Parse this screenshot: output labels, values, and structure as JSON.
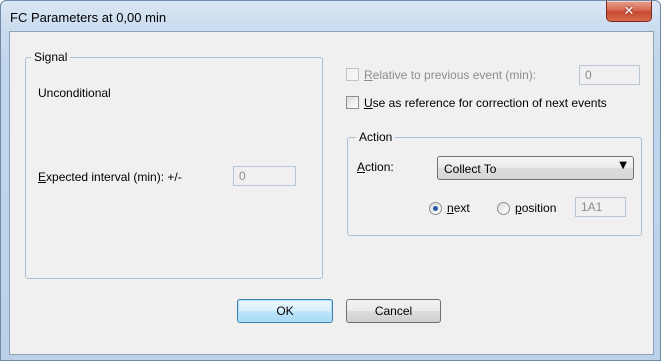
{
  "window": {
    "title": "FC Parameters at 0,00 min",
    "close_label": "✕"
  },
  "signal": {
    "legend": "Signal",
    "condition_text": "Unconditional",
    "expected_interval_label_key": "E",
    "expected_interval_label_rest": "xpected interval (min): +/-",
    "expected_interval_value": "0"
  },
  "relative": {
    "label_key": "R",
    "label_rest": "elative to previous event (min):",
    "checked": false,
    "enabled": false,
    "value": "0"
  },
  "use_reference": {
    "label_key": "U",
    "label_rest": "se as reference for correction of next events",
    "checked": false
  },
  "action_group": {
    "legend": "Action",
    "action_label_key": "A",
    "action_label_rest": "ction:",
    "action_value": "Collect To",
    "radio_next_key": "n",
    "radio_next_rest": "ext",
    "radio_position_key": "p",
    "radio_position_rest": "osition",
    "selected": "next",
    "position_value": "1A1"
  },
  "buttons": {
    "ok_label": "OK",
    "cancel_label": "Cancel"
  },
  "colors": {
    "title_bar": "#c9dbee",
    "close_button": "#c74a30",
    "group_border": "#a9c0d8",
    "default_button_border": "#3c7fb1",
    "radio_dot": "#2a5aa8"
  }
}
